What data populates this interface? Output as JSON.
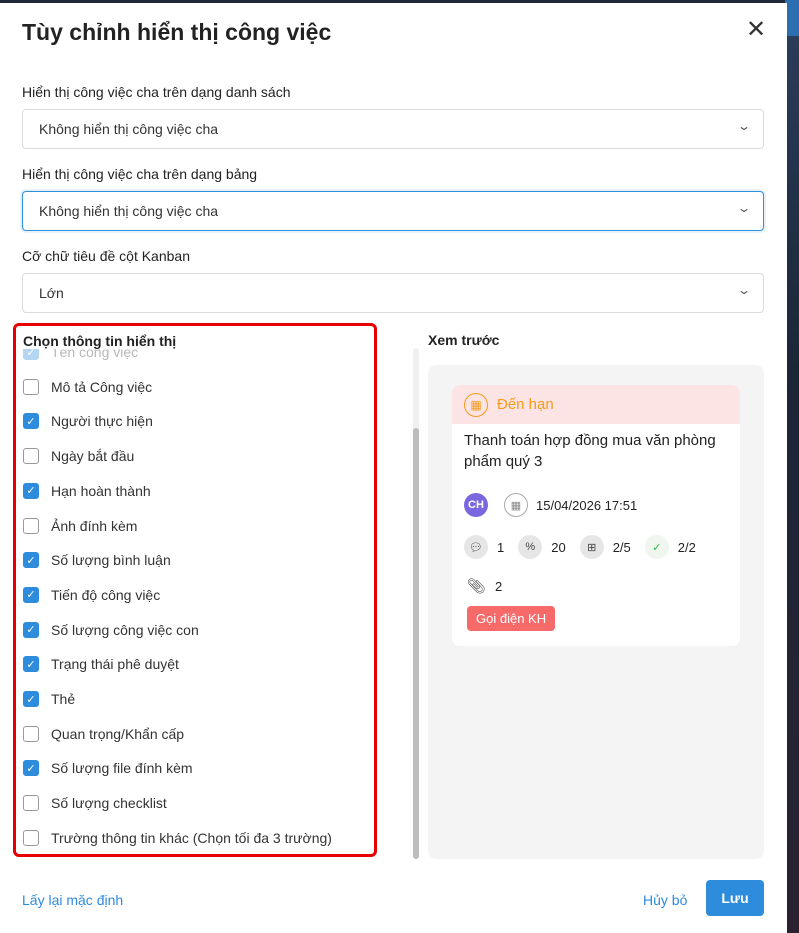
{
  "title": "Tùy chỉnh hiển thị công việc",
  "fields": [
    {
      "label": "Hiển thị công việc cha trên dạng danh sách",
      "value": "Không hiển thị công việc cha"
    },
    {
      "label": "Hiển thị công việc cha trên dạng bảng",
      "value": "Không hiển thị công việc cha"
    },
    {
      "label": "Cỡ chữ tiêu đề cột Kanban",
      "value": "Lớn"
    }
  ],
  "options_title": "Chọn thông tin hiển thị",
  "options": [
    {
      "label": "Tên công việc",
      "checked": true
    },
    {
      "label": "Mô tả Công việc",
      "checked": false
    },
    {
      "label": "Người thực hiện",
      "checked": true
    },
    {
      "label": "Ngày bắt đầu",
      "checked": false
    },
    {
      "label": "Hạn hoàn thành",
      "checked": true
    },
    {
      "label": "Ảnh đính kèm",
      "checked": false
    },
    {
      "label": "Số lượng bình luận",
      "checked": true
    },
    {
      "label": "Tiến độ công việc",
      "checked": true
    },
    {
      "label": "Số lượng công việc con",
      "checked": true
    },
    {
      "label": "Trạng thái phê duyệt",
      "checked": true
    },
    {
      "label": "Thẻ",
      "checked": true
    },
    {
      "label": "Quan trọng/Khẩn cấp",
      "checked": false
    },
    {
      "label": "Số lượng file đính kèm",
      "checked": true
    },
    {
      "label": "Số lượng checklist",
      "checked": false
    },
    {
      "label": "Trường thông tin khác (Chọn tối đa 3 trường)",
      "checked": false
    }
  ],
  "preview": {
    "label": "Xem trước",
    "status": "Đến hạn",
    "task_title": "Thanh toán hợp đồng mua văn phòng phẩm quý 3",
    "avatar": "CH",
    "due": "15/04/2026 17:51",
    "comments": "1",
    "progress": "20",
    "subtasks": "2/5",
    "approval": "2/2",
    "attachments": "2",
    "tag": "Gọi điện KH"
  },
  "footer": {
    "reset": "Lấy lại mặc định",
    "cancel": "Hủy bỏ",
    "save": "Lưu"
  }
}
